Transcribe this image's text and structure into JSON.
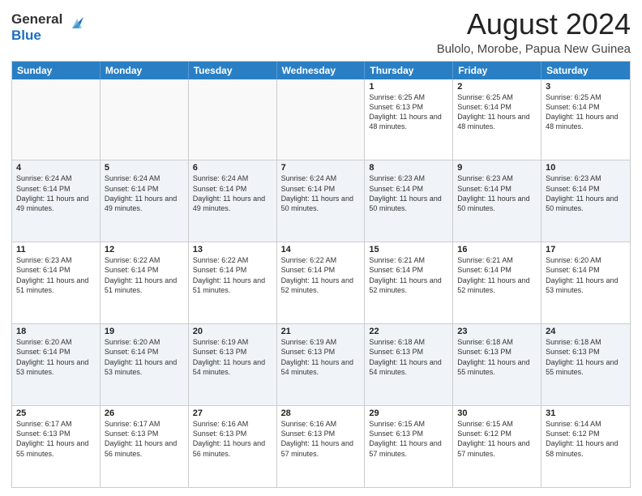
{
  "header": {
    "logo_general": "General",
    "logo_blue": "Blue",
    "month_year": "August 2024",
    "location": "Bulolo, Morobe, Papua New Guinea"
  },
  "weekdays": [
    "Sunday",
    "Monday",
    "Tuesday",
    "Wednesday",
    "Thursday",
    "Friday",
    "Saturday"
  ],
  "rows": [
    {
      "alt": false,
      "cells": [
        {
          "day": "",
          "info": ""
        },
        {
          "day": "",
          "info": ""
        },
        {
          "day": "",
          "info": ""
        },
        {
          "day": "",
          "info": ""
        },
        {
          "day": "1",
          "info": "Sunrise: 6:25 AM\nSunset: 6:13 PM\nDaylight: 11 hours and 48 minutes."
        },
        {
          "day": "2",
          "info": "Sunrise: 6:25 AM\nSunset: 6:14 PM\nDaylight: 11 hours and 48 minutes."
        },
        {
          "day": "3",
          "info": "Sunrise: 6:25 AM\nSunset: 6:14 PM\nDaylight: 11 hours and 48 minutes."
        }
      ]
    },
    {
      "alt": true,
      "cells": [
        {
          "day": "4",
          "info": "Sunrise: 6:24 AM\nSunset: 6:14 PM\nDaylight: 11 hours and 49 minutes."
        },
        {
          "day": "5",
          "info": "Sunrise: 6:24 AM\nSunset: 6:14 PM\nDaylight: 11 hours and 49 minutes."
        },
        {
          "day": "6",
          "info": "Sunrise: 6:24 AM\nSunset: 6:14 PM\nDaylight: 11 hours and 49 minutes."
        },
        {
          "day": "7",
          "info": "Sunrise: 6:24 AM\nSunset: 6:14 PM\nDaylight: 11 hours and 50 minutes."
        },
        {
          "day": "8",
          "info": "Sunrise: 6:23 AM\nSunset: 6:14 PM\nDaylight: 11 hours and 50 minutes."
        },
        {
          "day": "9",
          "info": "Sunrise: 6:23 AM\nSunset: 6:14 PM\nDaylight: 11 hours and 50 minutes."
        },
        {
          "day": "10",
          "info": "Sunrise: 6:23 AM\nSunset: 6:14 PM\nDaylight: 11 hours and 50 minutes."
        }
      ]
    },
    {
      "alt": false,
      "cells": [
        {
          "day": "11",
          "info": "Sunrise: 6:23 AM\nSunset: 6:14 PM\nDaylight: 11 hours and 51 minutes."
        },
        {
          "day": "12",
          "info": "Sunrise: 6:22 AM\nSunset: 6:14 PM\nDaylight: 11 hours and 51 minutes."
        },
        {
          "day": "13",
          "info": "Sunrise: 6:22 AM\nSunset: 6:14 PM\nDaylight: 11 hours and 51 minutes."
        },
        {
          "day": "14",
          "info": "Sunrise: 6:22 AM\nSunset: 6:14 PM\nDaylight: 11 hours and 52 minutes."
        },
        {
          "day": "15",
          "info": "Sunrise: 6:21 AM\nSunset: 6:14 PM\nDaylight: 11 hours and 52 minutes."
        },
        {
          "day": "16",
          "info": "Sunrise: 6:21 AM\nSunset: 6:14 PM\nDaylight: 11 hours and 52 minutes."
        },
        {
          "day": "17",
          "info": "Sunrise: 6:20 AM\nSunset: 6:14 PM\nDaylight: 11 hours and 53 minutes."
        }
      ]
    },
    {
      "alt": true,
      "cells": [
        {
          "day": "18",
          "info": "Sunrise: 6:20 AM\nSunset: 6:14 PM\nDaylight: 11 hours and 53 minutes."
        },
        {
          "day": "19",
          "info": "Sunrise: 6:20 AM\nSunset: 6:14 PM\nDaylight: 11 hours and 53 minutes."
        },
        {
          "day": "20",
          "info": "Sunrise: 6:19 AM\nSunset: 6:13 PM\nDaylight: 11 hours and 54 minutes."
        },
        {
          "day": "21",
          "info": "Sunrise: 6:19 AM\nSunset: 6:13 PM\nDaylight: 11 hours and 54 minutes."
        },
        {
          "day": "22",
          "info": "Sunrise: 6:18 AM\nSunset: 6:13 PM\nDaylight: 11 hours and 54 minutes."
        },
        {
          "day": "23",
          "info": "Sunrise: 6:18 AM\nSunset: 6:13 PM\nDaylight: 11 hours and 55 minutes."
        },
        {
          "day": "24",
          "info": "Sunrise: 6:18 AM\nSunset: 6:13 PM\nDaylight: 11 hours and 55 minutes."
        }
      ]
    },
    {
      "alt": false,
      "cells": [
        {
          "day": "25",
          "info": "Sunrise: 6:17 AM\nSunset: 6:13 PM\nDaylight: 11 hours and 55 minutes."
        },
        {
          "day": "26",
          "info": "Sunrise: 6:17 AM\nSunset: 6:13 PM\nDaylight: 11 hours and 56 minutes."
        },
        {
          "day": "27",
          "info": "Sunrise: 6:16 AM\nSunset: 6:13 PM\nDaylight: 11 hours and 56 minutes."
        },
        {
          "day": "28",
          "info": "Sunrise: 6:16 AM\nSunset: 6:13 PM\nDaylight: 11 hours and 57 minutes."
        },
        {
          "day": "29",
          "info": "Sunrise: 6:15 AM\nSunset: 6:13 PM\nDaylight: 11 hours and 57 minutes."
        },
        {
          "day": "30",
          "info": "Sunrise: 6:15 AM\nSunset: 6:12 PM\nDaylight: 11 hours and 57 minutes."
        },
        {
          "day": "31",
          "info": "Sunrise: 6:14 AM\nSunset: 6:12 PM\nDaylight: 11 hours and 58 minutes."
        }
      ]
    }
  ]
}
